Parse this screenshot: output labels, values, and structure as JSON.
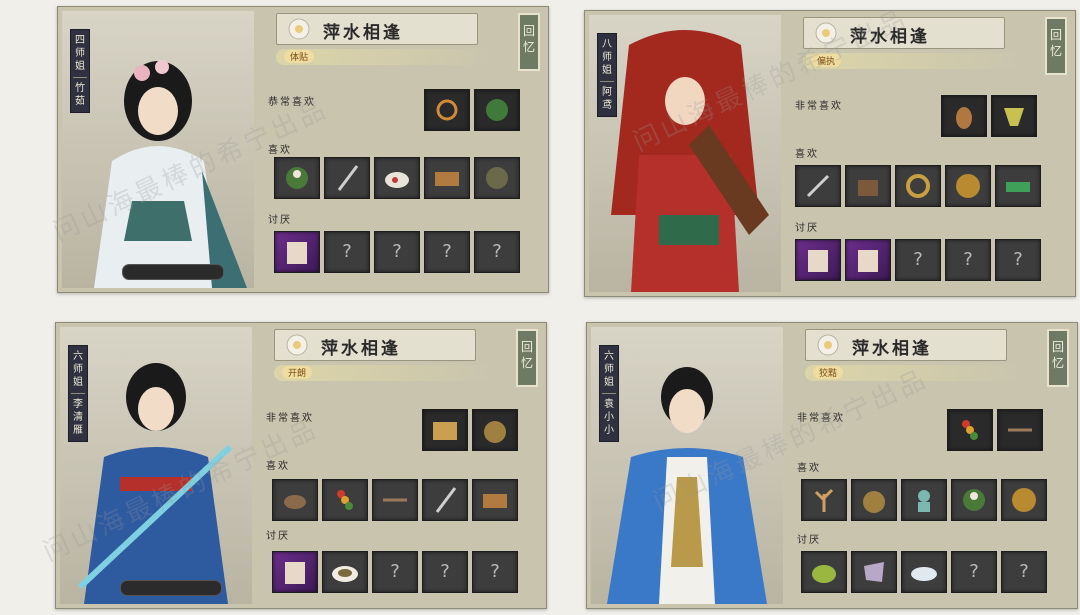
{
  "screen_title": "萍水相逢",
  "memory_label": "回忆",
  "sections": {
    "very_like": "非常喜欢",
    "like": "喜欢",
    "dislike": "讨厌"
  },
  "watermark": "问山海最棒的希宁出品",
  "panels": [
    {
      "rank": "四师姐",
      "name": "竹茹",
      "trait": "体贴",
      "very_like_label": "恭常喜欢"
    },
    {
      "rank": "八师姐",
      "name": "阿鸢",
      "trait": "偏执",
      "very_like_label": "非常喜欢"
    },
    {
      "rank": "六师姐",
      "name": "李清雁",
      "trait": "开朗",
      "very_like_label": "非常喜欢"
    },
    {
      "rank": "六师姐",
      "name": "袁小小",
      "trait": "狡黠",
      "very_like_label": "非常喜欢"
    }
  ],
  "unknown_mark": "?",
  "colors": {
    "panel": "#c9c4ae",
    "slot": "#3d3d3d",
    "purple_slot": "#6b2e8c",
    "memory": "#6e7a64"
  }
}
